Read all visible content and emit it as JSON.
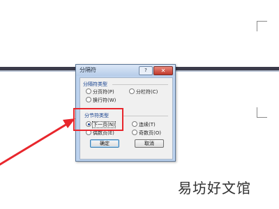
{
  "dialog": {
    "title": "分隔符",
    "help_label": "?",
    "close_label": "✕",
    "break_group": {
      "title": "分隔符类型",
      "options": [
        {
          "label": "分页符(P)",
          "selected": true
        },
        {
          "label": "分栏符(C)",
          "selected": false
        },
        {
          "label": "换行符(W)",
          "selected": false
        }
      ]
    },
    "section_group": {
      "title": "分节符类型",
      "options": [
        {
          "label": "下一页(N)",
          "selected": true
        },
        {
          "label": "连续(T)",
          "selected": false
        },
        {
          "label": "偶数页(E)",
          "selected": false
        },
        {
          "label": "奇数页(O)",
          "selected": false
        }
      ]
    },
    "ok_label": "确定",
    "cancel_label": "取消"
  },
  "annotation": {
    "highlight_color": "#e8262c"
  },
  "watermark": "易坊好文馆"
}
